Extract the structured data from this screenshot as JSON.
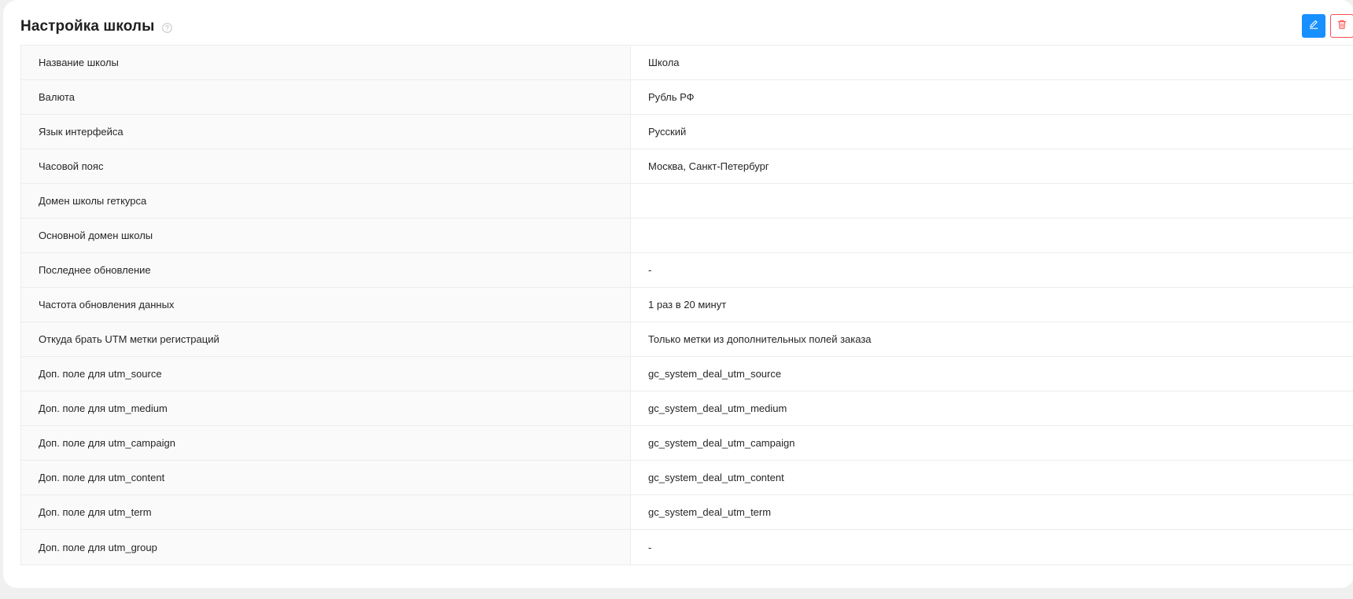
{
  "card": {
    "title": "Настройка школы",
    "help_icon": "question-circle-icon",
    "actions": {
      "edit_icon": "pencil-icon",
      "delete_icon": "trash-icon",
      "edit_color": "#1890ff",
      "delete_color": "#ff4d4f"
    }
  },
  "settings": [
    {
      "label": "Название школы",
      "value": "Школа"
    },
    {
      "label": "Валюта",
      "value": "Рубль РФ"
    },
    {
      "label": "Язык интерфейса",
      "value": "Русский"
    },
    {
      "label": "Часовой пояс",
      "value": "Москва, Санкт-Петербург"
    },
    {
      "label": "Домен школы геткурса",
      "value": ""
    },
    {
      "label": "Основной домен школы",
      "value": ""
    },
    {
      "label": "Последнее обновление",
      "value": "-"
    },
    {
      "label": "Частота обновления данных",
      "value": "1 раз в 20 минут"
    },
    {
      "label": "Откуда брать UTM метки регистраций",
      "value": "Только метки из дополнительных полей заказа"
    },
    {
      "label": "Доп. поле для utm_source",
      "value": "gc_system_deal_utm_source"
    },
    {
      "label": "Доп. поле для utm_medium",
      "value": "gc_system_deal_utm_medium"
    },
    {
      "label": "Доп. поле для utm_campaign",
      "value": "gc_system_deal_utm_campaign"
    },
    {
      "label": "Доп. поле для utm_content",
      "value": "gc_system_deal_utm_content"
    },
    {
      "label": "Доп. поле для utm_term",
      "value": "gc_system_deal_utm_term"
    },
    {
      "label": "Доп. поле для utm_group",
      "value": "-"
    }
  ]
}
